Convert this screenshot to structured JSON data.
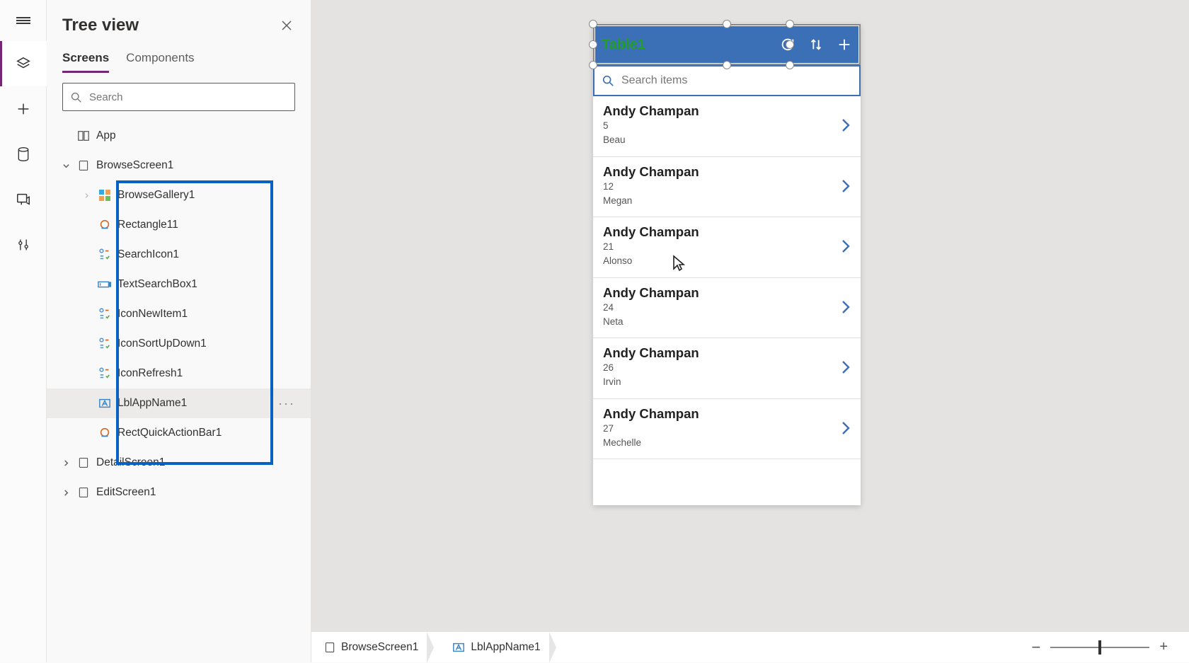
{
  "panel": {
    "title": "Tree view",
    "tabs": {
      "screens": "Screens",
      "components": "Components"
    },
    "searchPlaceholder": "Search",
    "app": "App"
  },
  "tree": {
    "browseScreen": "BrowseScreen1",
    "children": [
      "BrowseGallery1",
      "Rectangle11",
      "SearchIcon1",
      "TextSearchBox1",
      "IconNewItem1",
      "IconSortUpDown1",
      "IconRefresh1",
      "LblAppName1",
      "RectQuickActionBar1"
    ],
    "detailScreen": "DetailScreen1",
    "editScreen": "EditScreen1"
  },
  "phone": {
    "title": "Table1",
    "searchPlaceholder": "Search items",
    "items": [
      {
        "name": "Andy Champan",
        "v1": "5",
        "v2": "Beau"
      },
      {
        "name": "Andy Champan",
        "v1": "12",
        "v2": "Megan"
      },
      {
        "name": "Andy Champan",
        "v1": "21",
        "v2": "Alonso"
      },
      {
        "name": "Andy Champan",
        "v1": "24",
        "v2": "Neta"
      },
      {
        "name": "Andy Champan",
        "v1": "26",
        "v2": "Irvin"
      },
      {
        "name": "Andy Champan",
        "v1": "27",
        "v2": "Mechelle"
      }
    ]
  },
  "breadcrumb": {
    "a": "BrowseScreen1",
    "b": "LblAppName1"
  },
  "zoom": {
    "minus": "−",
    "plus": "+"
  }
}
